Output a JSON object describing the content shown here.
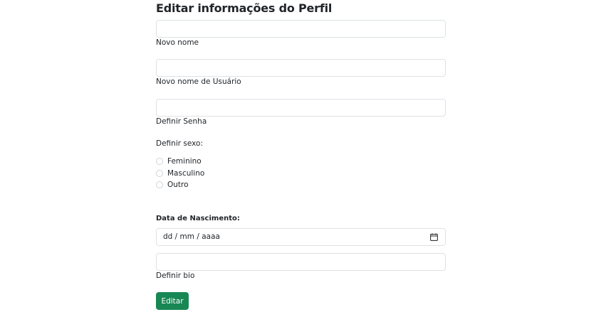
{
  "page": {
    "title": "Editar informações do Perfil"
  },
  "fields": {
    "nome": {
      "label": "Novo nome",
      "value": ""
    },
    "usuario": {
      "label": "Novo nome de Usuário",
      "value": ""
    },
    "senha": {
      "label": "Definir Senha",
      "value": ""
    },
    "bio": {
      "label": "Definir bio",
      "value": ""
    }
  },
  "sexo": {
    "label": "Definir sexo:",
    "options": [
      "Feminino",
      "Masculino",
      "Outro"
    ],
    "selected": null
  },
  "nascimento": {
    "label": "Data de Nascimento:",
    "placeholder": "dd / mm / aaaa",
    "icon": "calendar-icon"
  },
  "submit": {
    "label": "Editar",
    "color": "#198754"
  }
}
